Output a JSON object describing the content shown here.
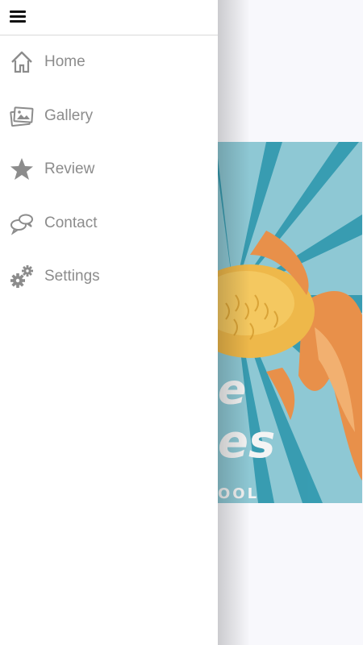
{
  "drawer": {
    "items": [
      {
        "label": "Home",
        "icon": "home-icon"
      },
      {
        "label": "Gallery",
        "icon": "gallery-icon"
      },
      {
        "label": "Review",
        "icon": "star-icon"
      },
      {
        "label": "Contact",
        "icon": "chat-icon"
      },
      {
        "label": "Settings",
        "icon": "gears-icon"
      }
    ]
  },
  "poster": {
    "word1": "e",
    "word2": "es",
    "word3": "OOL"
  },
  "colors": {
    "drawer_bg": "#ffffff",
    "label": "#8c8c8c",
    "poster_bg": "#8ec8d4",
    "poster_rays": "#2f98ae",
    "fish_orange": "#e8904a",
    "fish_yellow": "#eeb84a"
  }
}
